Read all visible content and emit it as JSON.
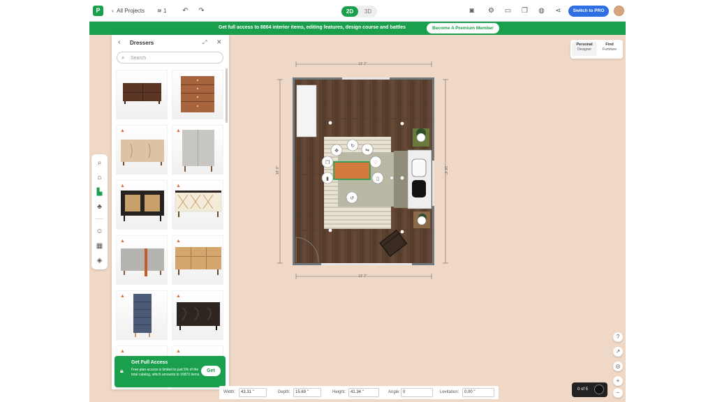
{
  "topbar": {
    "back_label": "All Projects",
    "floor_count": "1",
    "mode_2d": "2D",
    "mode_3d": "3D",
    "pro_button": "Switch to PRO"
  },
  "promo": {
    "text": "Get full access to 8864 interior items, editing features, design course and battles",
    "button": "Become A Premium Member"
  },
  "panel": {
    "title": "Dressers",
    "search_placeholder": "Search",
    "items": [
      {
        "name": "low-wood-dresser",
        "locked": false
      },
      {
        "name": "tall-wood-chest",
        "locked": false
      },
      {
        "name": "beige-sideboard",
        "locked": true
      },
      {
        "name": "grey-cabinet",
        "locked": true
      },
      {
        "name": "rattan-black-sideboard",
        "locked": true
      },
      {
        "name": "white-x-sideboard",
        "locked": true
      },
      {
        "name": "grey-orange-sideboard",
        "locked": true
      },
      {
        "name": "wood-sideboard",
        "locked": true
      },
      {
        "name": "blue-tall-chest",
        "locked": true
      },
      {
        "name": "dark-carved-dresser",
        "locked": true
      }
    ]
  },
  "access_popup": {
    "title": "Get Full Access",
    "description": "Free plan access is limited to just 5% of the total catalog, which amounts to 16873 items.",
    "button": "Get"
  },
  "view_switch": {
    "personal_title": "Personal",
    "personal_sub": "Designer",
    "find_title": "Find",
    "find_sub": "Furniture"
  },
  "dimensions": {
    "top": "13' 7\"",
    "bottom": "13' 7\"",
    "left": "18' 6\"",
    "right": "18' 6\""
  },
  "bottombar": {
    "width_label": "Width:",
    "width_value": "43.31 \"",
    "depth_label": "Depth:",
    "depth_value": "15.69 \"",
    "height_label": "Height:",
    "height_value": "41.34 \"",
    "angle_label": "Angle:",
    "angle_value": "0",
    "levitation_label": "Levitation:",
    "levitation_value": "0.00 \""
  },
  "pager": {
    "text": "0 of 5"
  },
  "colors": {
    "brand_green": "#1a9f4d",
    "pro_blue": "#2f6fe4",
    "canvas": "#efd8c6",
    "floor_wood": "#5d4331",
    "selected_item": "#d2793e"
  }
}
